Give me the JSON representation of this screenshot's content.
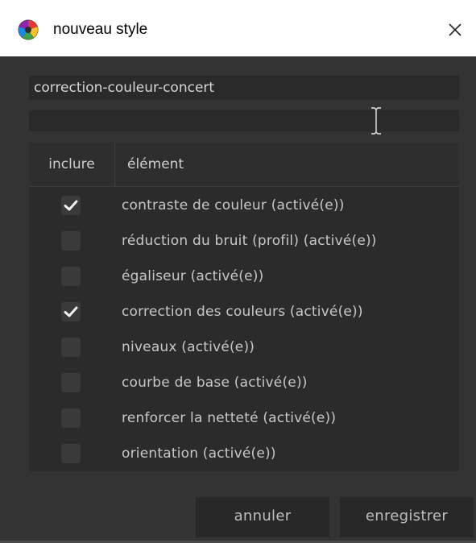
{
  "window": {
    "title": "nouveau style"
  },
  "form": {
    "name_value": "correction-couleur-concert",
    "description_value": ""
  },
  "table": {
    "headers": {
      "include": "inclure",
      "element": "élément"
    },
    "rows": [
      {
        "label": "contraste de couleur  (activé(e))",
        "checked": true
      },
      {
        "label": "réduction du bruit (profil)  (activé(e))",
        "checked": false
      },
      {
        "label": "égaliseur  (activé(e))",
        "checked": false
      },
      {
        "label": "correction des couleurs  (activé(e))",
        "checked": true
      },
      {
        "label": "niveaux  (activé(e))",
        "checked": false
      },
      {
        "label": "courbe de base  (activé(e))",
        "checked": false
      },
      {
        "label": "renforcer la netteté  (activé(e))",
        "checked": false
      },
      {
        "label": "orientation  (activé(e))",
        "checked": false
      }
    ]
  },
  "buttons": {
    "cancel": "annuler",
    "save": "enregistrer"
  },
  "icons": {
    "app": "darktable-app-icon",
    "close": "close-icon",
    "text-cursor": "ibeam-cursor-icon",
    "check": "checkmark-icon"
  },
  "colors": {
    "window_bg": "#333333",
    "field_bg": "#2a2a2a",
    "checkbox_bg": "#3a3a3a",
    "text": "#c8c8c8"
  }
}
